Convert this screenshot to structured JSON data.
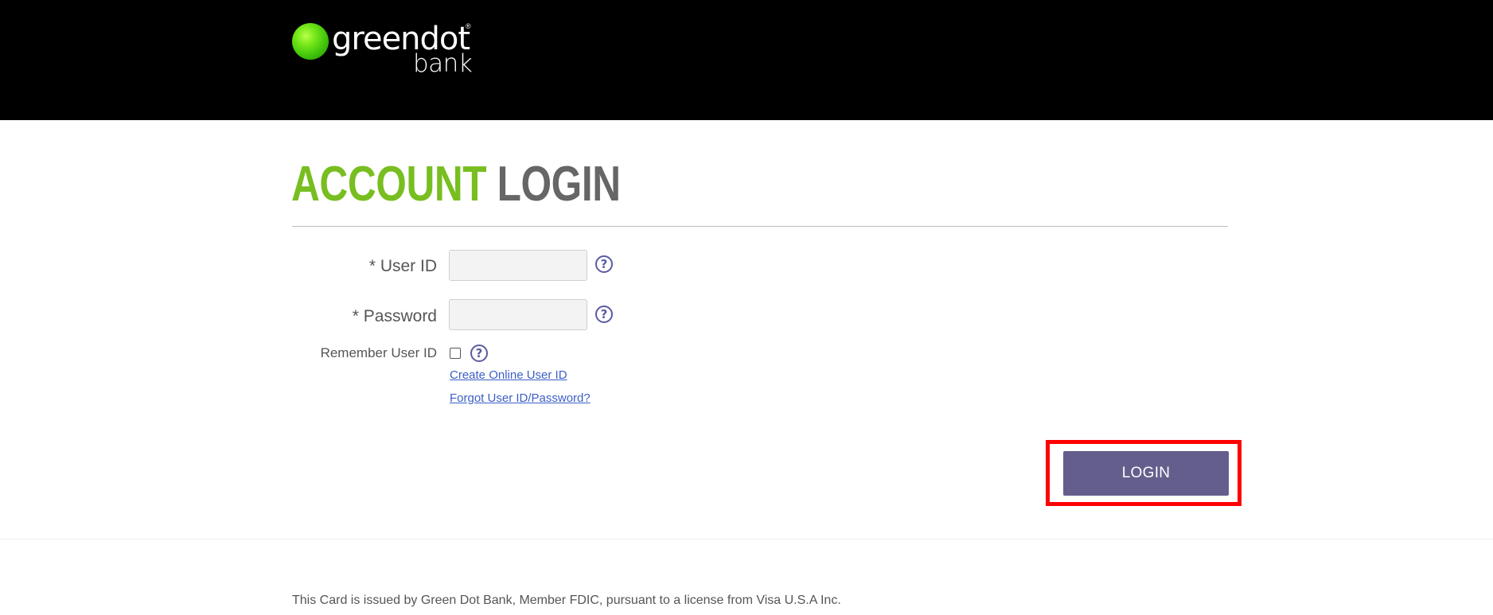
{
  "header": {
    "logo": {
      "brand": "greendot",
      "registered": "®",
      "sub": "bank"
    }
  },
  "main": {
    "title": {
      "part1": "ACCOUNT",
      "part2": "LOGIN"
    },
    "form": {
      "user_id_label": "* User ID",
      "user_id_value": "",
      "password_label": "* Password",
      "password_value": "",
      "remember_label": "Remember User ID",
      "remember_checked": false,
      "help_glyph": "?",
      "create_link": "Create Online User ID",
      "forgot_link": "Forgot User ID/Password?",
      "login_button": "LOGIN"
    }
  },
  "footer": {
    "disclaimer": "This Card is issued by Green Dot Bank, Member FDIC, pursuant to a license from Visa U.S.A Inc."
  },
  "colors": {
    "header_bg": "#000000",
    "title_green": "#78be20",
    "title_gray": "#666666",
    "help_purple": "#5b5aa3",
    "link_blue": "#3c5fc6",
    "button_bg": "#635e8c",
    "highlight_red": "#ff0000"
  },
  "icons": {
    "logo": "green-ball-logo-icon",
    "help": "question-circle-icon"
  }
}
